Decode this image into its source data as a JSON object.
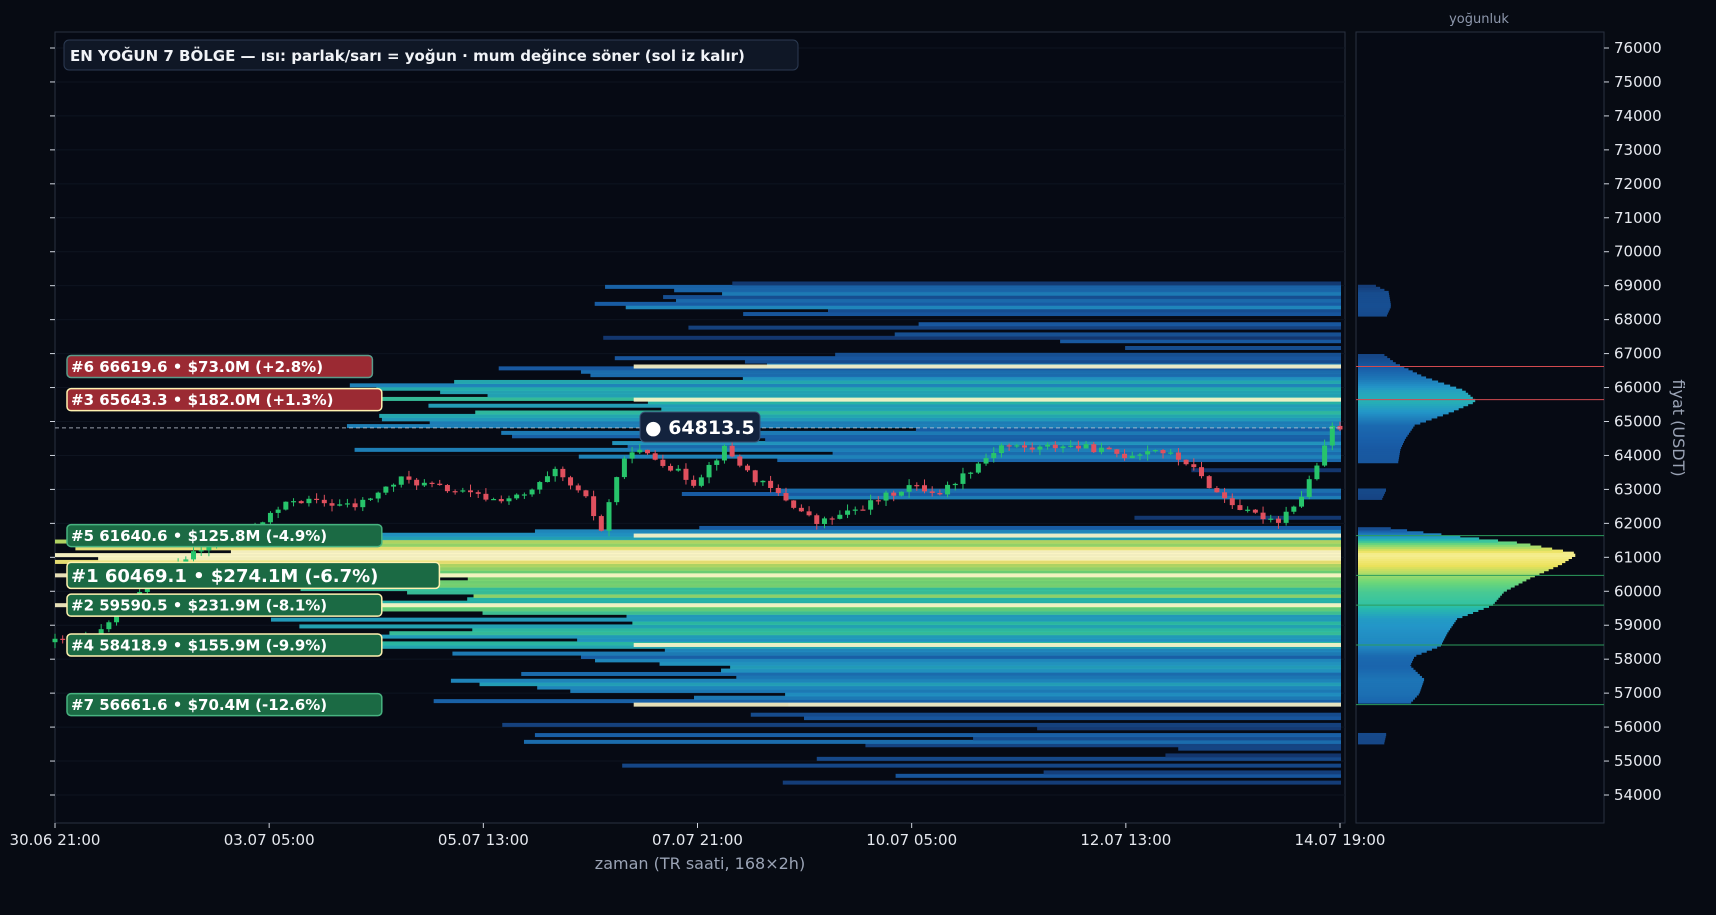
{
  "chart_data": {
    "type": "candlestick-heatmap",
    "title": "EN YOĞUN 7 BÖLGE — ısı: parlak/sarı = yoğun · mum değince söner (sol iz kalır)",
    "xlabel": "zaman (TR saati, 168×2h)",
    "ylabel": "fiyat (USDT)",
    "side_panel_label": "yoğunluk",
    "ylim": [
      53200,
      76500
    ],
    "y_ticks": [
      54000,
      55000,
      56000,
      57000,
      58000,
      59000,
      60000,
      61000,
      62000,
      63000,
      64000,
      65000,
      66000,
      67000,
      68000,
      69000,
      70000,
      71000,
      72000,
      73000,
      74000,
      75000,
      76000
    ],
    "x_ticks": [
      "30.06 21:00",
      "03.07 05:00",
      "05.07 13:00",
      "07.07 21:00",
      "10.07 05:00",
      "12.07 13:00",
      "14.07 19:00"
    ],
    "bars": 168,
    "bar_hours": 2,
    "current_price": 64813.5,
    "current_price_label": "● 64813.5",
    "zones": [
      {
        "rank": 1,
        "price": 60469.1,
        "volume": "$274.1M",
        "change": "(-6.7%)",
        "label": "#1  60469.1  •  $274.1M  (-6.7%)",
        "side": "support"
      },
      {
        "rank": 2,
        "price": 59590.5,
        "volume": "$231.9M",
        "change": "(-8.1%)",
        "label": "#2  59590.5  •  $231.9M  (-8.1%)",
        "side": "support"
      },
      {
        "rank": 3,
        "price": 65643.3,
        "volume": "$182.0M",
        "change": "(+1.3%)",
        "label": "#3  65643.3  •  $182.0M  (+1.3%)",
        "side": "resistance"
      },
      {
        "rank": 4,
        "price": 58418.9,
        "volume": "$155.9M",
        "change": "(-9.9%)",
        "label": "#4  58418.9  •  $155.9M  (-9.9%)",
        "side": "support"
      },
      {
        "rank": 5,
        "price": 61640.6,
        "volume": "$125.8M",
        "change": "(-4.9%)",
        "label": "#5  61640.6  •  $125.8M  (-4.9%)",
        "side": "support"
      },
      {
        "rank": 6,
        "price": 66619.6,
        "volume": "$73.0M",
        "change": "(+2.8%)",
        "label": "#6  66619.6  •  $73.0M  (+2.8%)",
        "side": "resistance"
      },
      {
        "rank": 7,
        "price": 56661.6,
        "volume": "$70.4M",
        "change": "(-12.6%)",
        "label": "#7  56661.6  •  $70.4M  (-12.6%)",
        "side": "support"
      }
    ],
    "price_path": [
      {
        "t": 0,
        "p": 58500
      },
      {
        "t": 6,
        "p": 58600
      },
      {
        "t": 10,
        "p": 59600
      },
      {
        "t": 14,
        "p": 60500
      },
      {
        "t": 20,
        "p": 61200
      },
      {
        "t": 26,
        "p": 61800
      },
      {
        "t": 32,
        "p": 62700
      },
      {
        "t": 40,
        "p": 62500
      },
      {
        "t": 46,
        "p": 63300
      },
      {
        "t": 52,
        "p": 63000
      },
      {
        "t": 58,
        "p": 62700
      },
      {
        "t": 62,
        "p": 62800
      },
      {
        "t": 66,
        "p": 63500
      },
      {
        "t": 70,
        "p": 62700
      },
      {
        "t": 72,
        "p": 61800
      },
      {
        "t": 74,
        "p": 63400
      },
      {
        "t": 76,
        "p": 64200
      },
      {
        "t": 80,
        "p": 63800
      },
      {
        "t": 84,
        "p": 63200
      },
      {
        "t": 88,
        "p": 64200
      },
      {
        "t": 92,
        "p": 63300
      },
      {
        "t": 96,
        "p": 62700
      },
      {
        "t": 100,
        "p": 62000
      },
      {
        "t": 104,
        "p": 62300
      },
      {
        "t": 108,
        "p": 62700
      },
      {
        "t": 112,
        "p": 63100
      },
      {
        "t": 116,
        "p": 62900
      },
      {
        "t": 120,
        "p": 63600
      },
      {
        "t": 124,
        "p": 64300
      },
      {
        "t": 128,
        "p": 64200
      },
      {
        "t": 132,
        "p": 64300
      },
      {
        "t": 136,
        "p": 64200
      },
      {
        "t": 140,
        "p": 64000
      },
      {
        "t": 144,
        "p": 64200
      },
      {
        "t": 148,
        "p": 63800
      },
      {
        "t": 152,
        "p": 62900
      },
      {
        "t": 156,
        "p": 62300
      },
      {
        "t": 160,
        "p": 62100
      },
      {
        "t": 163,
        "p": 62800
      },
      {
        "t": 166,
        "p": 64200
      },
      {
        "t": 167,
        "p": 64813.5
      }
    ],
    "profile": [
      {
        "price": 55500,
        "d": 0.11
      },
      {
        "price": 55800,
        "d": 0.12
      },
      {
        "price": 56700,
        "d": 0.22
      },
      {
        "price": 57000,
        "d": 0.26
      },
      {
        "price": 57400,
        "d": 0.28
      },
      {
        "price": 57800,
        "d": 0.22
      },
      {
        "price": 58100,
        "d": 0.24
      },
      {
        "price": 58400,
        "d": 0.35
      },
      {
        "price": 58800,
        "d": 0.38
      },
      {
        "price": 59200,
        "d": 0.42
      },
      {
        "price": 59600,
        "d": 0.57
      },
      {
        "price": 60000,
        "d": 0.62
      },
      {
        "price": 60400,
        "d": 0.73
      },
      {
        "price": 60800,
        "d": 0.86
      },
      {
        "price": 61100,
        "d": 0.93
      },
      {
        "price": 61400,
        "d": 0.7
      },
      {
        "price": 61700,
        "d": 0.3
      },
      {
        "price": 61900,
        "d": 0.07
      },
      {
        "price": 62700,
        "d": 0.1
      },
      {
        "price": 63000,
        "d": 0.12
      },
      {
        "price": 63800,
        "d": 0.17
      },
      {
        "price": 64200,
        "d": 0.18
      },
      {
        "price": 64500,
        "d": 0.2
      },
      {
        "price": 64900,
        "d": 0.24
      },
      {
        "price": 65300,
        "d": 0.4
      },
      {
        "price": 65600,
        "d": 0.5
      },
      {
        "price": 65900,
        "d": 0.45
      },
      {
        "price": 66300,
        "d": 0.28
      },
      {
        "price": 66700,
        "d": 0.16
      },
      {
        "price": 67000,
        "d": 0.1
      },
      {
        "price": 68100,
        "d": 0.12
      },
      {
        "price": 68400,
        "d": 0.14
      },
      {
        "price": 68800,
        "d": 0.13
      },
      {
        "price": 69000,
        "d": 0.07
      }
    ]
  }
}
